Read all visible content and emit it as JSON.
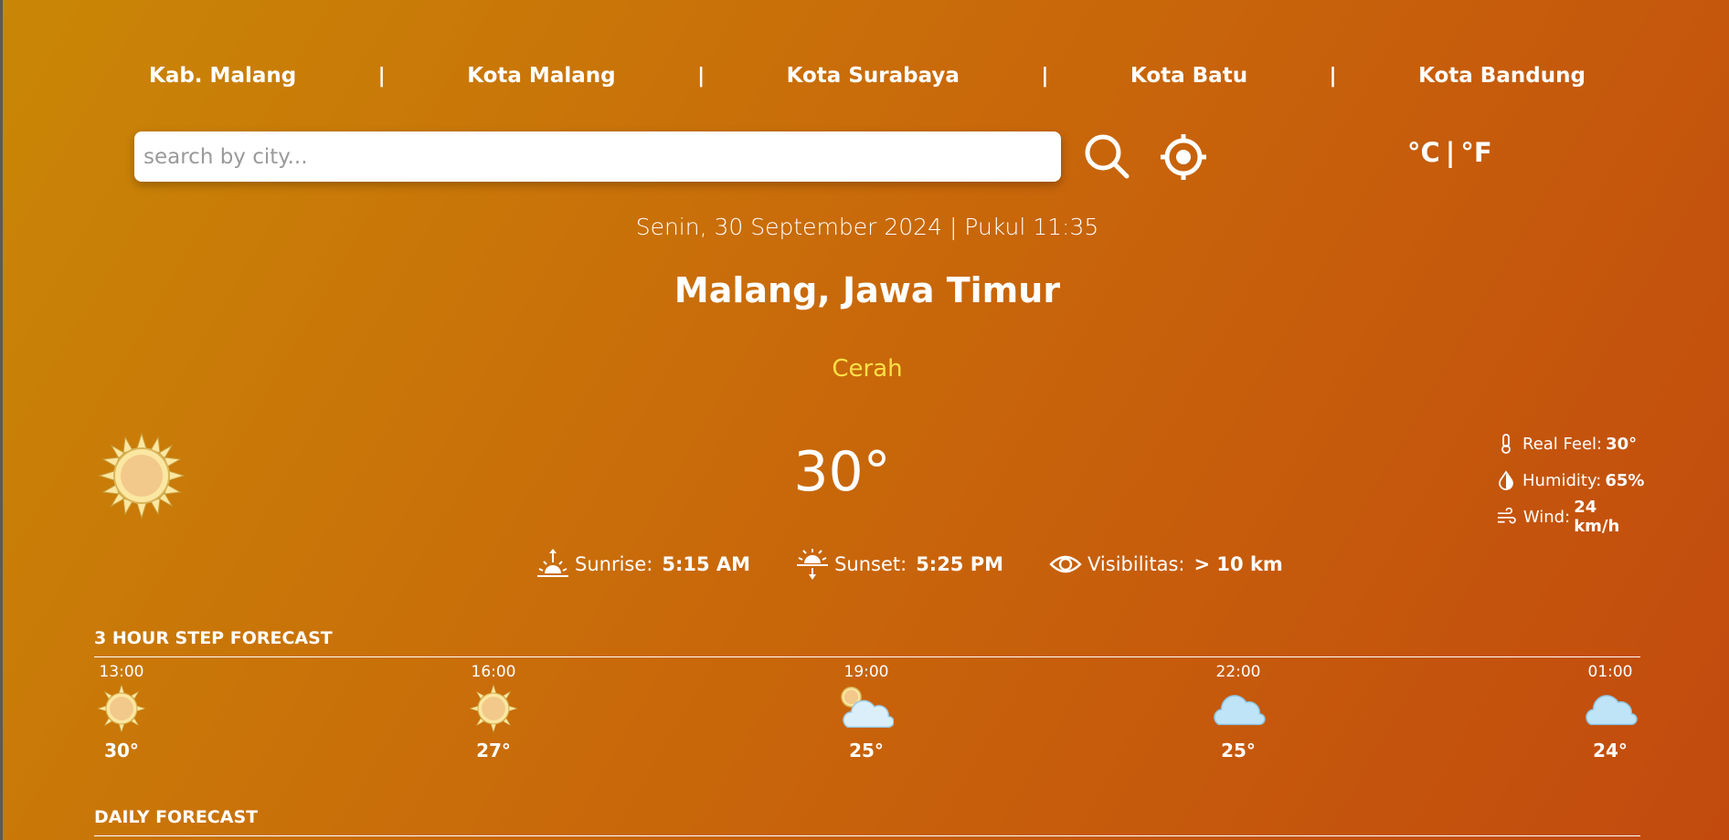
{
  "nav": {
    "cities": [
      "Kab. Malang",
      "Kota Malang",
      "Kota Surabaya",
      "Kota Batu",
      "Kota Bandung"
    ],
    "separator": "|"
  },
  "search": {
    "placeholder": "search by city...",
    "value": ""
  },
  "units": {
    "celsius": "°C",
    "separator": "|",
    "fahrenheit": "°F"
  },
  "datetime": "Senin, 30 September 2024 | Pukul 11:35",
  "location": "Malang, Jawa Timur",
  "condition": "Cerah",
  "current": {
    "icon": "sun-icon",
    "temperature": "30°",
    "real_feel_label": "Real Feel:",
    "real_feel": "30°",
    "humidity_label": "Humidity:",
    "humidity": "65%",
    "wind_label": "Wind:",
    "wind": "24 km/h"
  },
  "sun": {
    "sunrise_label": "Sunrise:",
    "sunrise": "5:15 AM",
    "sunset_label": "Sunset:",
    "sunset": "5:25 PM",
    "visibility_label": "Visibilitas:",
    "visibility": "> 10 km"
  },
  "hourly": {
    "title": "3 hour step forecast",
    "items": [
      {
        "time": "13:00",
        "icon": "sun-icon",
        "temp": "30°"
      },
      {
        "time": "16:00",
        "icon": "sun-icon",
        "temp": "27°"
      },
      {
        "time": "19:00",
        "icon": "partly-cloudy-icon",
        "temp": "25°"
      },
      {
        "time": "22:00",
        "icon": "cloud-icon",
        "temp": "25°"
      },
      {
        "time": "01:00",
        "icon": "cloud-icon",
        "temp": "24°"
      }
    ]
  },
  "daily": {
    "title": "daily forecast"
  },
  "colors": {
    "background_start": "#c98706",
    "background_end": "#c24a0e",
    "condition": "#fde047",
    "sun_fill": "#f2c98a",
    "cloud_fill": "#bfe3f7"
  }
}
